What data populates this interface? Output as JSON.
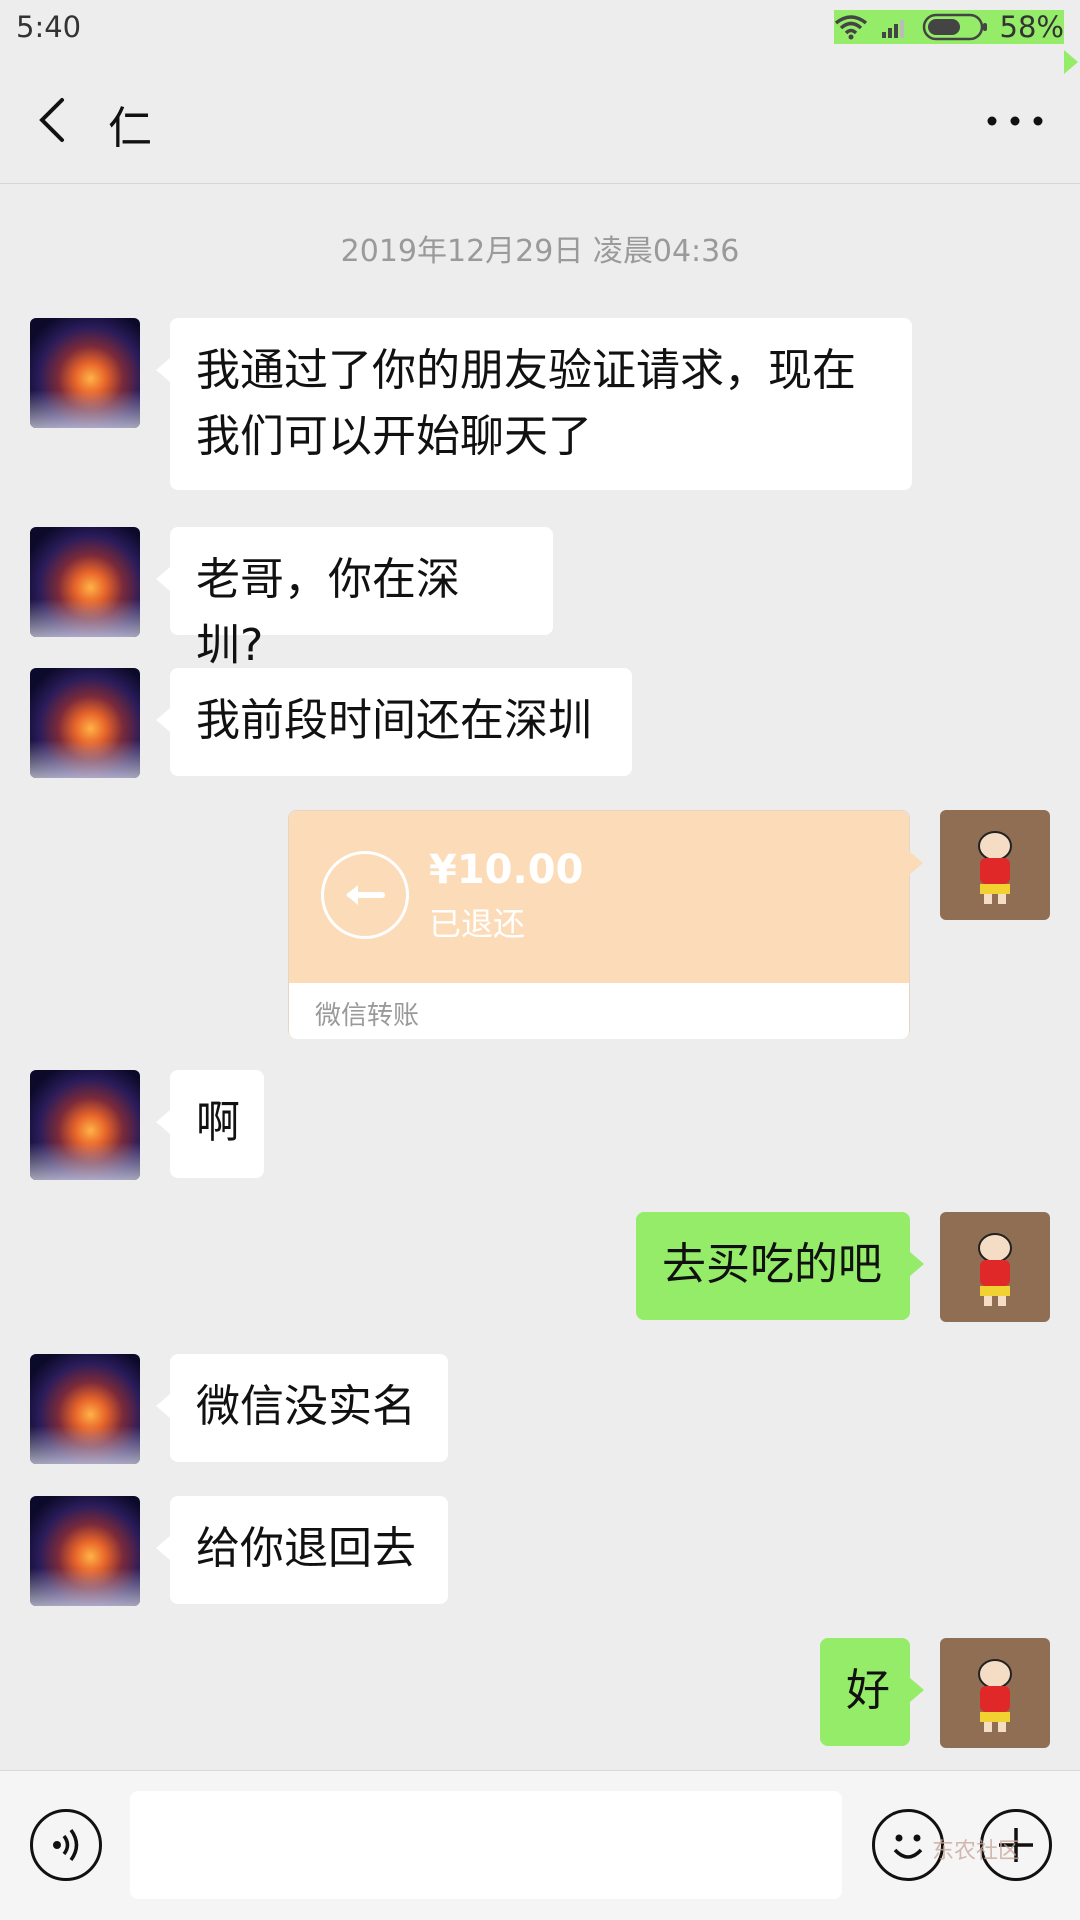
{
  "status": {
    "time": "5:40",
    "battery": "58%"
  },
  "header": {
    "title": "仁"
  },
  "chat": {
    "timestamp": "2019年12月29日 凌晨04:36",
    "messages": [
      {
        "side": "left",
        "text": "我通过了你的朋友验证请求，现在我们可以开始聊天了"
      },
      {
        "side": "left",
        "text": "老哥，你在深圳?"
      },
      {
        "side": "left",
        "text": "我前段时间还在深圳"
      },
      {
        "side": "right",
        "type": "transfer",
        "amount": "¥10.00",
        "status": "已退还",
        "label": "微信转账"
      },
      {
        "side": "left",
        "text": "啊"
      },
      {
        "side": "right",
        "text": "去买吃的吧"
      },
      {
        "side": "left",
        "text": "微信没实名"
      },
      {
        "side": "left",
        "text": "给你退回去"
      },
      {
        "side": "right",
        "text": "好"
      }
    ]
  },
  "watermark": "东农社区",
  "colors": {
    "incoming": "#ffffff",
    "outgoing": "#95ec69",
    "transfer": "#fcdcb8",
    "background": "#ededed"
  }
}
